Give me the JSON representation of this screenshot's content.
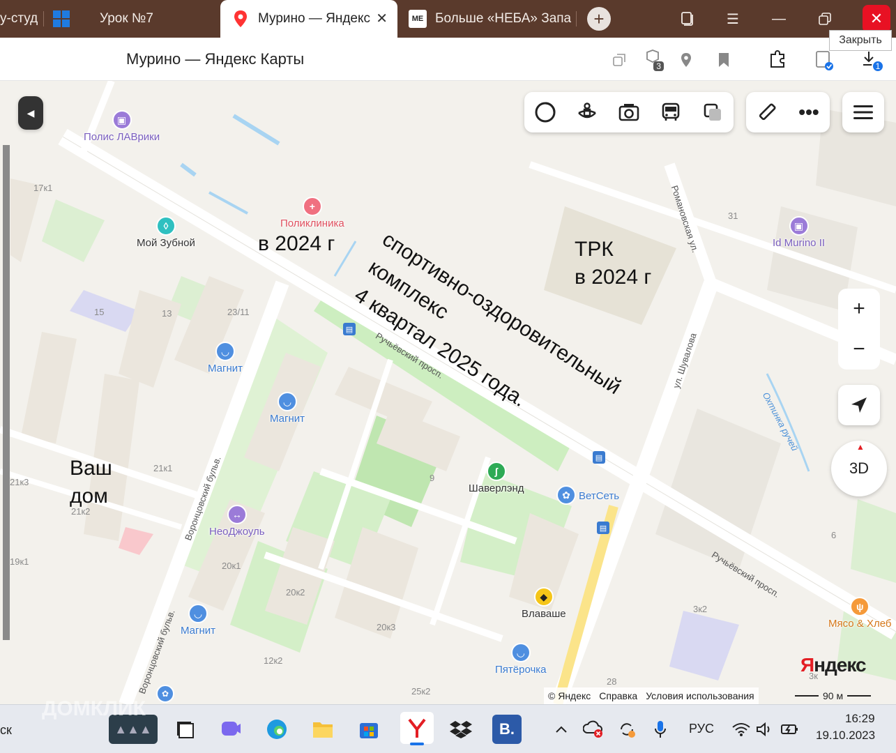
{
  "browser": {
    "tabs": [
      {
        "label": "у-студ",
        "icon": "globe-icon"
      },
      {
        "label": "Урок №7",
        "icon": "windows-icon"
      },
      {
        "label": "Мурино — Яндекс",
        "icon": "map-pin-icon",
        "active": true
      },
      {
        "label": "Больше «НЕБА» Запа",
        "icon": "me-icon"
      }
    ],
    "tooltip": "Закрыть",
    "colors": {
      "tabbar": "#5a3a2c",
      "close": "#e81123"
    }
  },
  "titlebar": {
    "title": "Мурино — Яндекс Карты",
    "bookmarks_badge": "3",
    "downloads_badge": "1"
  },
  "map": {
    "pois": [
      {
        "name": "Полис ЛАВрики",
        "color": "#9b7bd8"
      },
      {
        "name": "Поликлиника",
        "color": "#f07080"
      },
      {
        "name": "Мой Зубной",
        "color": "#2fc0c0"
      },
      {
        "name": "Магнит",
        "color": "#4f8fe0"
      },
      {
        "name": "Магнит",
        "color": "#4f8fe0"
      },
      {
        "name": "Магнит",
        "color": "#4f8fe0"
      },
      {
        "name": "НеоДжоуль",
        "color": "#9b7bd8"
      },
      {
        "name": "Шаверлэнд",
        "color": "#2daa55"
      },
      {
        "name": "ВетСеть",
        "color": "#4f8fe0"
      },
      {
        "name": "Влаваше",
        "color": "#f5c518"
      },
      {
        "name": "Пятёрочка",
        "color": "#4f8fe0"
      },
      {
        "name": "Id Murino II",
        "color": "#9b7bd8"
      },
      {
        "name": "Мясо & Хлеб",
        "color": "#f59a3a"
      }
    ],
    "house_numbers": [
      "17к1",
      "15",
      "13",
      "23/11",
      "31",
      "21к3",
      "21к1",
      "21к2",
      "19к1",
      "20к1",
      "20к2",
      "20к3",
      "9",
      "12к2",
      "25к2",
      "3к2",
      "28",
      "6",
      "3к"
    ],
    "streets": [
      "Романовская ул.",
      "ул. Шувалова",
      "Ручьёвский просп.",
      "Ручьёвский просп.",
      "Воронцовский бульв.",
      "Воронцовский бульв.",
      "Охтинка ручей"
    ],
    "annotations": {
      "clinic": "в 2024 г",
      "mall_1": "ТРК",
      "mall_2": "в 2024 г",
      "sport_1": "спортивно-оздоровительный",
      "sport_2": "комплекс",
      "sport_3": "4 квартал 2025 года.",
      "home_1": "Ваш",
      "home_2": "дом"
    },
    "controls": {
      "zoom_in": "+",
      "zoom_out": "−",
      "three_d": "3D"
    },
    "logo": "Яндекс",
    "copyright": [
      "© Яндекс",
      "Справка",
      "Условия использования"
    ],
    "scale": "90 м"
  },
  "taskbar": {
    "left_text": "ск",
    "watermark": "ДОМКЛИК",
    "lang": "РУС",
    "time": "16:29",
    "date": "19.10.2023"
  }
}
